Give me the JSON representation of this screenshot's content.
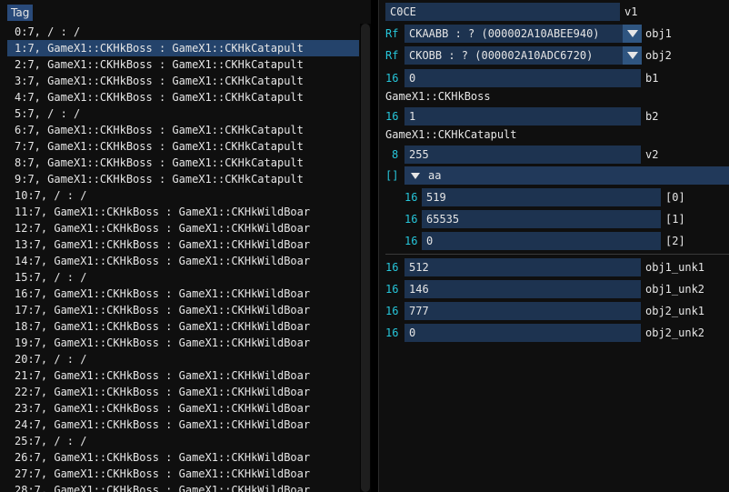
{
  "left": {
    "tab_label": "Tag",
    "rows": [
      "0:7, / : /",
      "1:7, GameX1::CKHkBoss : GameX1::CKHkCatapult",
      "2:7, GameX1::CKHkBoss : GameX1::CKHkCatapult",
      "3:7, GameX1::CKHkBoss : GameX1::CKHkCatapult",
      "4:7, GameX1::CKHkBoss : GameX1::CKHkCatapult",
      "5:7, / : /",
      "6:7, GameX1::CKHkBoss : GameX1::CKHkCatapult",
      "7:7, GameX1::CKHkBoss : GameX1::CKHkCatapult",
      "8:7, GameX1::CKHkBoss : GameX1::CKHkCatapult",
      "9:7, GameX1::CKHkBoss : GameX1::CKHkCatapult",
      "10:7, / : /",
      "11:7, GameX1::CKHkBoss : GameX1::CKHkWildBoar",
      "12:7, GameX1::CKHkBoss : GameX1::CKHkWildBoar",
      "13:7, GameX1::CKHkBoss : GameX1::CKHkWildBoar",
      "14:7, GameX1::CKHkBoss : GameX1::CKHkWildBoar",
      "15:7, / : /",
      "16:7, GameX1::CKHkBoss : GameX1::CKHkWildBoar",
      "17:7, GameX1::CKHkBoss : GameX1::CKHkWildBoar",
      "18:7, GameX1::CKHkBoss : GameX1::CKHkWildBoar",
      "19:7, GameX1::CKHkBoss : GameX1::CKHkWildBoar",
      "20:7, / : /",
      "21:7, GameX1::CKHkBoss : GameX1::CKHkWildBoar",
      "22:7, GameX1::CKHkBoss : GameX1::CKHkWildBoar",
      "23:7, GameX1::CKHkBoss : GameX1::CKHkWildBoar",
      "24:7, GameX1::CKHkBoss : GameX1::CKHkWildBoar",
      "25:7, / : /",
      "26:7, GameX1::CKHkBoss : GameX1::CKHkWildBoar",
      "27:7, GameX1::CKHkBoss : GameX1::CKHkWildBoar",
      "28:7, GameX1::CKHkBoss : GameX1::CKHkWildBoar"
    ],
    "selected_index": 1
  },
  "right": {
    "v1": {
      "value": "C0CE",
      "label": "v1"
    },
    "obj1": {
      "prefix": "Rf",
      "value": "CKAABB : ? (000002A10ABEE940)",
      "label": "obj1",
      "icon": "chevron-down-icon"
    },
    "obj2": {
      "prefix": "Rf",
      "value": "CKOBB : ? (000002A10ADC6720)",
      "label": "obj2",
      "icon": "chevron-down-icon"
    },
    "b1": {
      "prefix": "16",
      "value": "0",
      "label": "b1"
    },
    "class1_label": "GameX1::CKHkBoss",
    "b2": {
      "prefix": "16",
      "value": "1",
      "label": "b2"
    },
    "class2_label": "GameX1::CKHkCatapult",
    "v2": {
      "prefix": "8",
      "value": "255",
      "label": "v2"
    },
    "aa": {
      "prefix": "[]",
      "label": "aa",
      "items": [
        {
          "prefix": "16",
          "value": "519",
          "label": "[0]"
        },
        {
          "prefix": "16",
          "value": "65535",
          "label": "[1]"
        },
        {
          "prefix": "16",
          "value": "0",
          "label": "[2]"
        }
      ]
    },
    "obj1_unk1": {
      "prefix": "16",
      "value": "512",
      "label": "obj1_unk1"
    },
    "obj1_unk2": {
      "prefix": "16",
      "value": "146",
      "label": "obj1_unk2"
    },
    "obj2_unk1": {
      "prefix": "16",
      "value": "777",
      "label": "obj2_unk1"
    },
    "obj2_unk2": {
      "prefix": "16",
      "value": "0",
      "label": "obj2_unk2"
    }
  },
  "colors": {
    "accent": "#26c6da",
    "field_bg": "#1d3350",
    "selection": "#24436b",
    "tab_bg": "#294a7a"
  }
}
